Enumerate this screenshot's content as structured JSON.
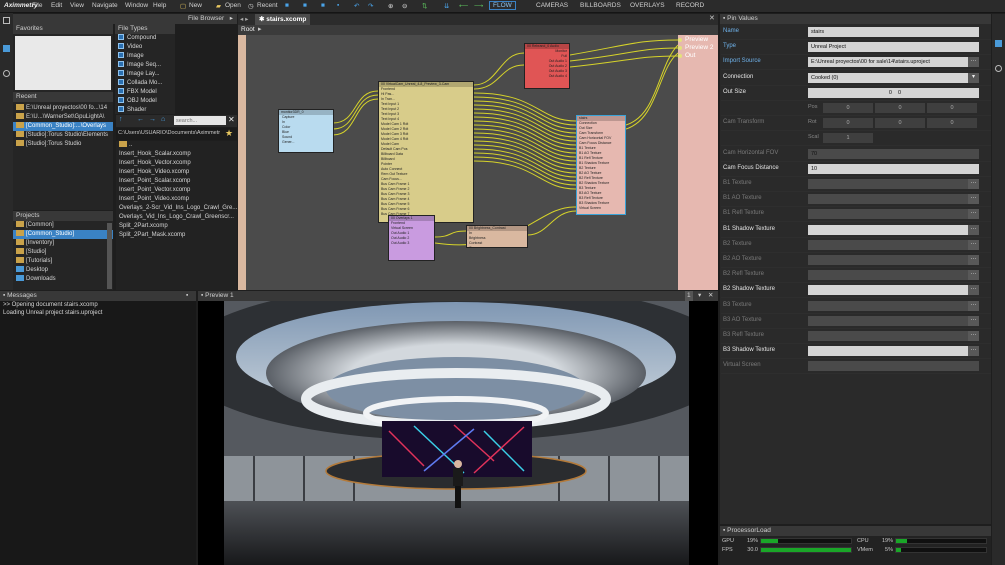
{
  "menubar": {
    "logo": "Aximmetry",
    "items": [
      "File",
      "Edit",
      "View",
      "Navigate",
      "Window",
      "Help"
    ],
    "new": "New",
    "open": "Open",
    "recent": "Recent",
    "modes": [
      "FLOW",
      "CAMERAS",
      "BILLBOARDS",
      "OVERLAYS",
      "RECORD"
    ]
  },
  "file_browser": {
    "title": "File Browser",
    "favorites": "Favorites",
    "file_types_label": "File Types",
    "file_types": [
      "Compound",
      "Video",
      "Image",
      "Image Seq...",
      "Image Lay...",
      "Collada Mo...",
      "FBX Model",
      "OBJ Model",
      "Shader"
    ],
    "recent_label": "Recent",
    "recent": [
      "E:\\Unreal proyectos\\00 fo...\\14",
      "E:\\U...\\WarnerSet\\GpuLightA\\",
      "[Common_Studio]:...\\Overlays",
      "[Studio]:Torus Studio\\Elements",
      "[Studio]:Torus Studio"
    ],
    "projects_label": "Projects",
    "projects": [
      "[Common]",
      "[Common_Studio]",
      "[Inventory]",
      "[Studio]",
      "[Tutorials]",
      "Desktop",
      "Downloads"
    ],
    "search_placeholder": "search...",
    "path": "C:\\Users\\USUARIO\\Documents\\Aximmetr",
    "files": [
      "..",
      "Insert_Hook_Scalar.xcomp",
      "Insert_Hook_Vector.xcomp",
      "Insert_Hook_Video.xcomp",
      "Insert_Point_Scalar.xcomp",
      "Insert_Point_Vector.xcomp",
      "Insert_Point_Video.xcomp",
      "Overlays_2-Scr_Vid_Ins_Logo_Crawl_Gre...",
      "Overlays_Vid_Ins_Logo_Crawl_Greenscr...",
      "Split_2Part.xcomp",
      "Split_2Part_Mask.xcomp"
    ]
  },
  "flow": {
    "tab": "stairs.xcomp",
    "root": "Root",
    "outputs": [
      "Preview",
      "Preview 2",
      "Out"
    ],
    "nodes": {
      "camera": {
        "title": "00 VirtualCam_Unreal_4-8_Preview_3-Cam",
        "pins": [
          "Frontend",
          "Hi Pas...",
          "In Tran...",
          "Text Input 1",
          "Text Input 2",
          "Text Input 3",
          "Text Input 4",
          "Model Cam 1 Rdt",
          "Model Cam 2 Rdt",
          "Model Cam 3 Rdt",
          "Model Cam 4 Rdt",
          "Model Cam",
          "Default Cam Pos",
          "Billboard Data",
          "Billboard",
          "Pointer",
          "Auto Connect",
          "Rem Out Texture",
          "Cam Focus...",
          "Bus Cam Frame 1",
          "Bus Cam Frame 2",
          "Bus Cam Frame 3",
          "Bus Cam Frame 4",
          "Bus Cam Frame 5",
          "Bus Cam Frame 6",
          "Bus Cam Frame 7"
        ]
      },
      "stairs": {
        "title": "stairs",
        "pins": [
          "Connection",
          "Out Size",
          "Cam Transform",
          "Cam Horizontal FOV",
          "Cam Focus Distance",
          "B1 Texture",
          "B1 AO Texture",
          "B1 Refl Texture",
          "B1 Shadow Texture",
          "B2 Texture",
          "B2 AO Texture",
          "B2 Refl Texture",
          "B2 Shadow Texture",
          "B3 Texture",
          "B3 AO Texture",
          "B3 Refl Texture",
          "B3 Shadow Texture",
          "Virtual Screen"
        ]
      },
      "mixer": {
        "title": "00 Rebrand_0 Audio",
        "pins": [
          "Monitor",
          "Full",
          "Out Audio 1",
          "Out Audio 2",
          "Out Audio 3",
          "Out Audio 4"
        ]
      },
      "overlays": {
        "title": "00 Overlays 1",
        "pins": [
          "Frontend",
          "Virtual Screen",
          "Out Audio 1",
          "Out Audio 2",
          "Out Audio 3"
        ]
      },
      "brightness": {
        "title": "00 Brightness_Contrast",
        "pins": [
          "In",
          "Brightness",
          "Contrast",
          "Gamma"
        ]
      },
      "capture": {
        "title": "monitor3DR_0",
        "pins": [
          "Capture",
          "In",
          "Color",
          "Blue",
          "Sound",
          "Gener..."
        ]
      }
    }
  },
  "messages": {
    "title": "Messages",
    "lines": [
      ">> Opening document stairs.xcomp",
      "Loading Unreal project stairs.uproject"
    ]
  },
  "preview": {
    "title": "Preview 1",
    "number": "1"
  },
  "pin_values": {
    "title": "Pin Values",
    "rows": [
      {
        "label": "Name",
        "value": "stairs",
        "active": true,
        "blue": true
      },
      {
        "label": "Type",
        "value": "Unreal Project",
        "active": true,
        "blue": true
      },
      {
        "label": "Import Source",
        "value": "E:\\Unreal proyectos\\00 for sale\\14\\stairs.uproject",
        "active": true,
        "blue": true,
        "dots": true
      },
      {
        "label": "Connection",
        "value": "Cooked (0)",
        "active": true
      },
      {
        "label": "Out Size",
        "value": "0    0",
        "active": true
      },
      {
        "label": "",
        "value": "",
        "sub": [
          "Pos",
          "0",
          "0",
          "0"
        ]
      },
      {
        "label": "Cam Transform",
        "value": "",
        "sub": [
          "Rot",
          "0",
          "0",
          "0"
        ]
      },
      {
        "label": "",
        "value": "",
        "sub": [
          "Scal",
          "1"
        ]
      },
      {
        "label": "Cam Horizontal FOV",
        "value": "70",
        "active": false
      },
      {
        "label": "Cam Focus Distance",
        "value": "10",
        "active": true
      },
      {
        "label": "B1 Texture",
        "value": "",
        "active": false,
        "dots": true
      },
      {
        "label": "B1 AO Texture",
        "value": "",
        "active": false,
        "dots": true
      },
      {
        "label": "B1 Refl Texture",
        "value": "",
        "active": false,
        "dots": true
      },
      {
        "label": "B1 Shadow Texture",
        "value": "",
        "active": true,
        "dots": true
      },
      {
        "label": "B2 Texture",
        "value": "",
        "active": false,
        "dots": true
      },
      {
        "label": "B2 AO Texture",
        "value": "",
        "active": false,
        "dots": true
      },
      {
        "label": "B2 Refl Texture",
        "value": "",
        "active": false,
        "dots": true
      },
      {
        "label": "B2 Shadow Texture",
        "value": "",
        "active": true,
        "dots": true
      },
      {
        "label": "B3 Texture",
        "value": "",
        "active": false,
        "dots": true
      },
      {
        "label": "B3 AO Texture",
        "value": "",
        "active": false,
        "dots": true
      },
      {
        "label": "B3 Refl Texture",
        "value": "",
        "active": false,
        "dots": true
      },
      {
        "label": "B3 Shadow Texture",
        "value": "",
        "active": true,
        "dots": true
      },
      {
        "label": "Virtual Screen",
        "value": "",
        "active": false
      }
    ]
  },
  "processor_load": {
    "title": "ProcessorLoad",
    "gpu_label": "GPU",
    "gpu": "19%",
    "gpu_level": 0.19,
    "fps_label": "FPS",
    "fps": "30.0",
    "fps_level": 1.0,
    "cpu_label": "CPU",
    "cpu": "19%",
    "cpu_level": 0.12,
    "vmem_label": "VMem",
    "vmem": "5%",
    "vmem_level": 0.05
  },
  "colors": {
    "accent": "#3a82c4",
    "flow_bg": "#4b4b4b",
    "node_yellow": "#d8cc8a",
    "node_red": "#e05555",
    "node_pink": "#e6b8b0",
    "node_purple": "#c99be0",
    "node_tan": "#d9b8a0",
    "node_blue": "#b9dbef",
    "link": "#d6d32a",
    "progress": "#1aa628"
  }
}
